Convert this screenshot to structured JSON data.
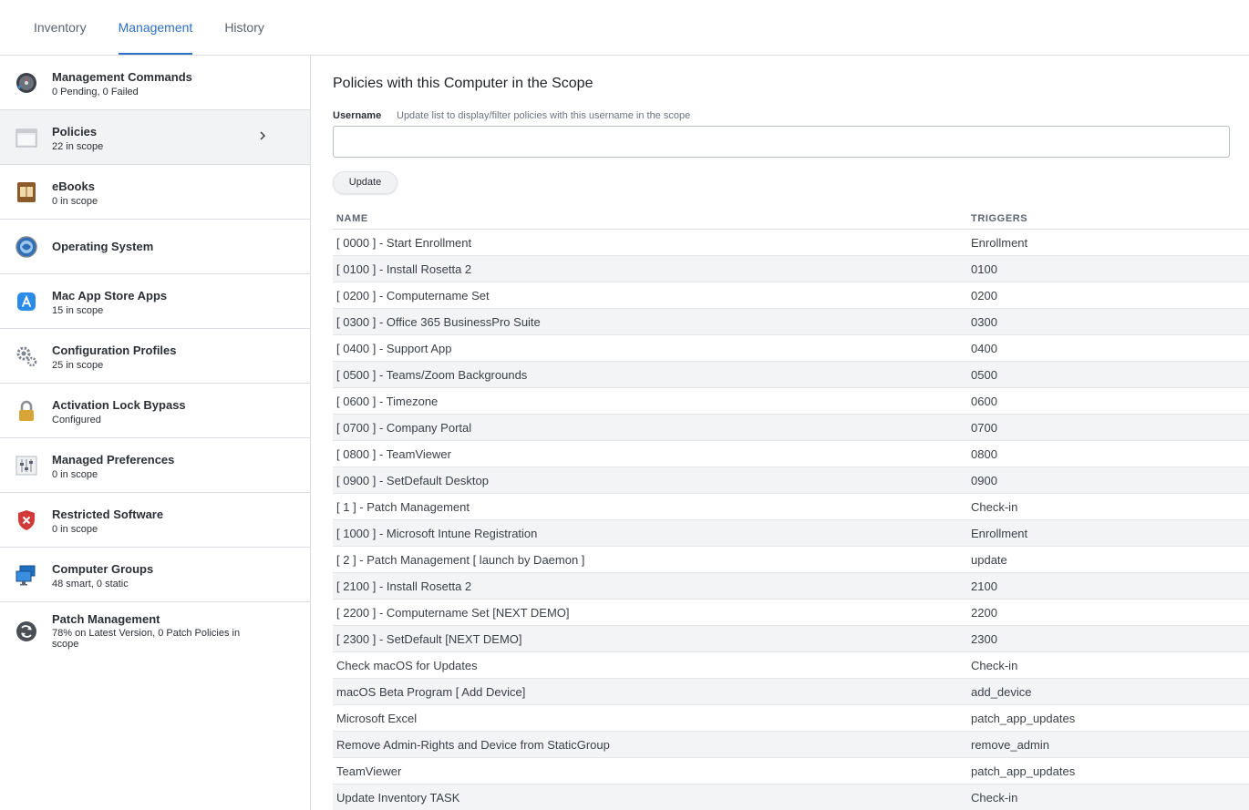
{
  "tabs": [
    {
      "label": "Inventory",
      "active": false
    },
    {
      "label": "Management",
      "active": true
    },
    {
      "label": "History",
      "active": false
    }
  ],
  "colors": {
    "accent": "#2d6fc4",
    "row_alt": "#f2f4f6",
    "selected": "#f2f3f5"
  },
  "sidebar": {
    "items": [
      {
        "title": "Management Commands",
        "sub": "0 Pending, 0 Failed",
        "icon": "management-commands-icon"
      },
      {
        "title": "Policies",
        "sub": "22 in scope",
        "icon": "policies-icon",
        "selected": true
      },
      {
        "title": "eBooks",
        "sub": "0 in scope",
        "icon": "ebooks-icon"
      },
      {
        "title": "Operating System",
        "sub": "",
        "icon": "operating-system-icon"
      },
      {
        "title": "Mac App Store Apps",
        "sub": "15 in scope",
        "icon": "app-store-icon"
      },
      {
        "title": "Configuration Profiles",
        "sub": "25 in scope",
        "icon": "gears-icon"
      },
      {
        "title": "Activation Lock Bypass",
        "sub": "Configured",
        "icon": "lock-icon"
      },
      {
        "title": "Managed Preferences",
        "sub": "0 in scope",
        "icon": "sliders-icon"
      },
      {
        "title": "Restricted Software",
        "sub": "0 in scope",
        "icon": "shield-icon"
      },
      {
        "title": "Computer Groups",
        "sub": "48 smart, 0 static",
        "icon": "computer-groups-icon"
      },
      {
        "title": "Patch Management",
        "sub": "78% on Latest Version, 0 Patch Policies in scope",
        "icon": "patch-icon"
      }
    ]
  },
  "main": {
    "title": "Policies with this Computer in the Scope",
    "username_label": "Username",
    "username_help": "Update list to display/filter policies with this username in the scope",
    "username_value": "",
    "update_button": "Update",
    "columns": {
      "name": "NAME",
      "triggers": "TRIGGERS"
    },
    "rows": [
      {
        "name": "[ 0000 ] - Start Enrollment",
        "trigger": "Enrollment"
      },
      {
        "name": "[ 0100 ] - Install Rosetta 2",
        "trigger": "0100"
      },
      {
        "name": "[ 0200 ] - Computername Set",
        "trigger": "0200"
      },
      {
        "name": "[ 0300 ] - Office 365 BusinessPro Suite",
        "trigger": "0300"
      },
      {
        "name": "[ 0400 ] - Support App",
        "trigger": "0400"
      },
      {
        "name": "[ 0500 ] - Teams/Zoom Backgrounds",
        "trigger": "0500"
      },
      {
        "name": "[ 0600 ] - Timezone",
        "trigger": "0600"
      },
      {
        "name": "[ 0700 ] - Company Portal",
        "trigger": "0700"
      },
      {
        "name": "[ 0800 ] - TeamViewer",
        "trigger": "0800"
      },
      {
        "name": "[ 0900 ] - SetDefault Desktop",
        "trigger": "0900"
      },
      {
        "name": "[ 1 ] - Patch Management",
        "trigger": "Check-in"
      },
      {
        "name": "[ 1000 ] - Microsoft Intune Registration",
        "trigger": "Enrollment"
      },
      {
        "name": "[ 2 ] - Patch Management [ launch by Daemon ]",
        "trigger": "update"
      },
      {
        "name": "[ 2100 ] - Install Rosetta 2",
        "trigger": "2100"
      },
      {
        "name": "[ 2200 ] - Computername Set [NEXT DEMO]",
        "trigger": "2200"
      },
      {
        "name": "[ 2300 ] - SetDefault [NEXT DEMO]",
        "trigger": "2300"
      },
      {
        "name": "Check macOS for Updates",
        "trigger": "Check-in"
      },
      {
        "name": "macOS Beta Program [ Add Device]",
        "trigger": "add_device"
      },
      {
        "name": "Microsoft Excel",
        "trigger": "patch_app_updates"
      },
      {
        "name": "Remove Admin-Rights and Device from StaticGroup",
        "trigger": "remove_admin"
      },
      {
        "name": "TeamViewer",
        "trigger": "patch_app_updates"
      },
      {
        "name": "Update Inventory TASK",
        "trigger": "Check-in"
      }
    ]
  }
}
